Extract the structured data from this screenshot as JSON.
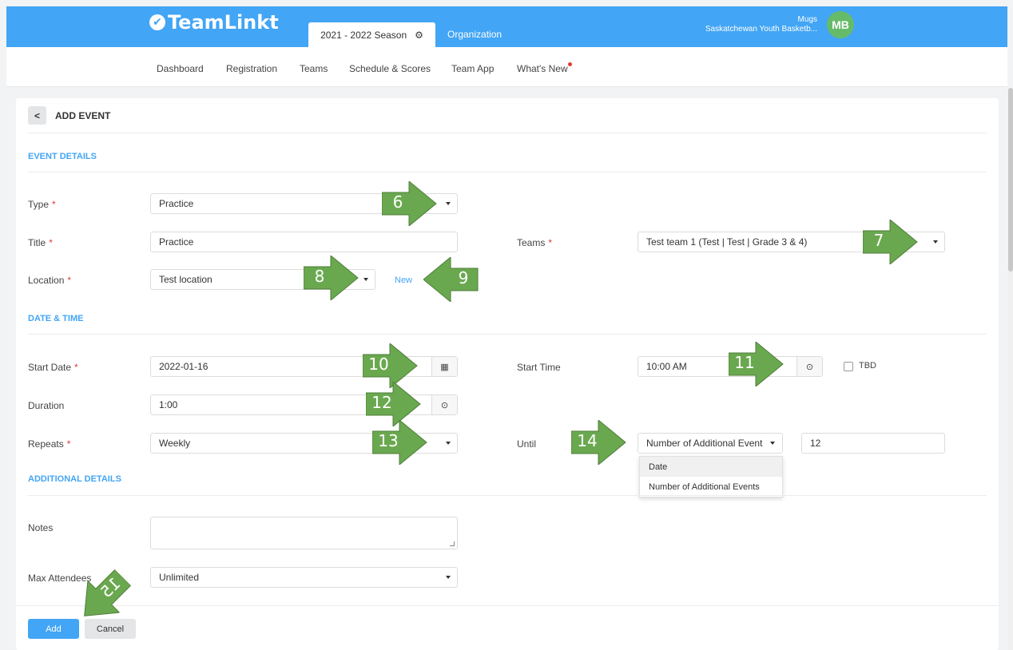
{
  "header": {
    "logo_check": "✔",
    "logo_text": "TeamLinkt",
    "season_tab": "2021 - 2022 Season",
    "org_tab": "Organization",
    "user_name": "Mugs",
    "user_org": "Saskatchewan Youth Basketb...",
    "avatar_initials": "MB"
  },
  "nav": {
    "items": [
      "Dashboard",
      "Registration",
      "Teams",
      "Schedule & Scores",
      "Team App",
      "What's New"
    ]
  },
  "page": {
    "back_label": "<",
    "title": "ADD EVENT"
  },
  "sections": {
    "event_details": "EVENT DETAILS",
    "date_time": "DATE & TIME",
    "additional_details": "ADDITIONAL DETAILS"
  },
  "form": {
    "type_label": "Type",
    "type_value": "Practice",
    "title_label": "Title",
    "title_value": "Practice",
    "teams_label": "Teams",
    "teams_value": "Test team 1 (Test | Test | Grade 3 & 4)",
    "location_label": "Location",
    "location_value": "Test location",
    "new_link": "New",
    "start_date_label": "Start Date",
    "start_date_value": "2022-01-16",
    "start_time_label": "Start Time",
    "start_time_value": "10:00 AM",
    "tbd_label": "TBD",
    "duration_label": "Duration",
    "duration_value": "1:00",
    "repeats_label": "Repeats",
    "repeats_value": "Weekly",
    "until_label": "Until",
    "until_value": "Number of Additional Event",
    "until_count": "12",
    "until_options": [
      "Date",
      "Number of Additional Events"
    ],
    "notes_label": "Notes",
    "notes_value": "",
    "max_attendees_label": "Max Attendees",
    "max_attendees_value": "Unlimited",
    "required_mark": "*"
  },
  "buttons": {
    "add": "Add",
    "cancel": "Cancel"
  },
  "annotations": [
    "6",
    "7",
    "8",
    "9",
    "10",
    "11",
    "12",
    "13",
    "14",
    "15"
  ],
  "colors": {
    "brand_blue": "#42a5f5",
    "avatar_green": "#66bb6a",
    "annotation_green": "#6aa84f",
    "required_red": "#e53935"
  }
}
